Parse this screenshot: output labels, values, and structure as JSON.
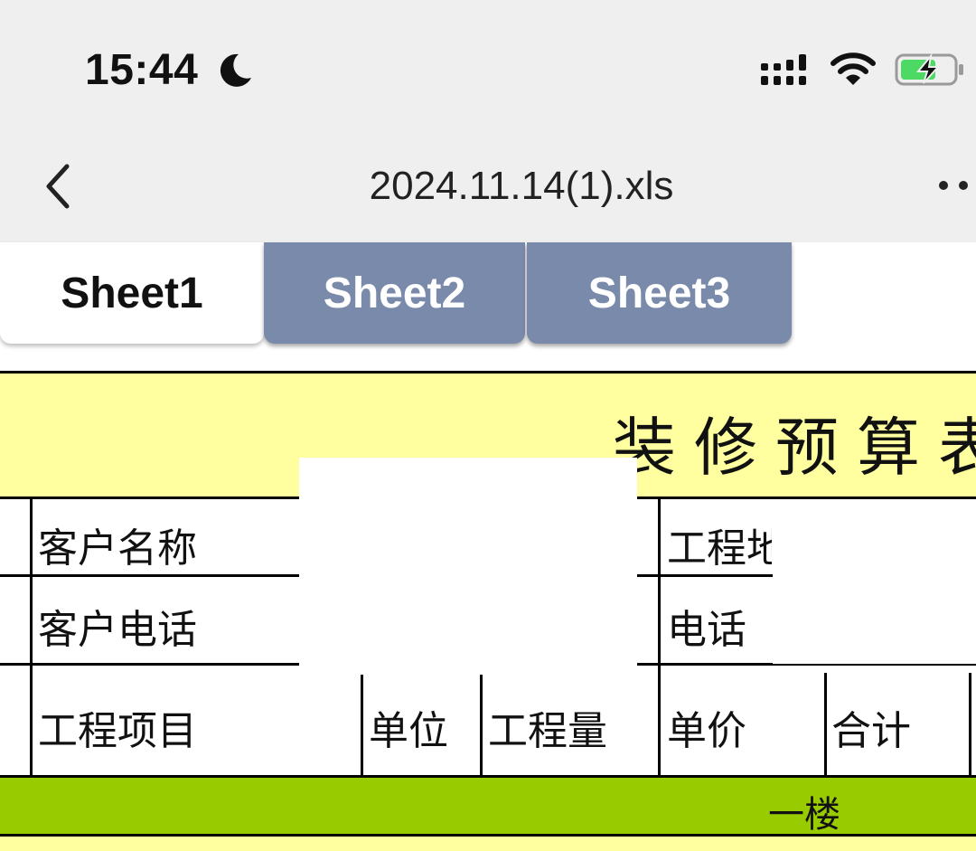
{
  "status": {
    "time": "15:44"
  },
  "nav": {
    "title": "2024.11.14(1).xls"
  },
  "tabs": [
    {
      "label": "Sheet1",
      "active": true
    },
    {
      "label": "Sheet2",
      "active": false
    },
    {
      "label": "Sheet3",
      "active": false
    }
  ],
  "sheet": {
    "title": "装修预算表",
    "rows": {
      "client_name": "客户名称",
      "project_addr": "工程地",
      "client_phone": "客户电话",
      "phone": "电话"
    },
    "headers": {
      "item": "工程项目",
      "unit": "单位",
      "quantity": "工程量",
      "unit_price": "单价",
      "total": "合计"
    },
    "section": "一楼"
  },
  "colors": {
    "title_bg": "#ffffa0",
    "section_bg": "#99cc00",
    "tab_inactive": "#7a8aaa",
    "battery_green": "#4cd964"
  }
}
